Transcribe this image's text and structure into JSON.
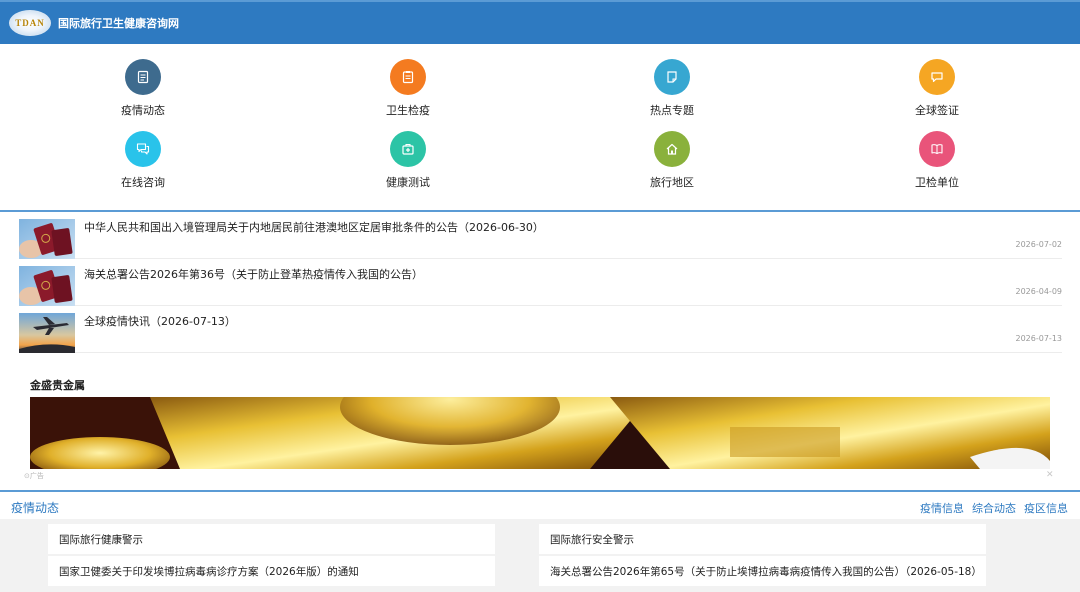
{
  "header": {
    "logo_text": "TDAN",
    "title": "国际旅行卫生健康咨询网",
    "brand_color": "#2e7ac1"
  },
  "nav": [
    {
      "label": "疫情动态",
      "icon": "document-icon",
      "color": "#3e6b8e"
    },
    {
      "label": "卫生检疫",
      "icon": "clipboard-icon",
      "color": "#f47b20"
    },
    {
      "label": "热点专题",
      "icon": "page-icon",
      "color": "#37a7d1"
    },
    {
      "label": "全球签证",
      "icon": "chat-bubble-icon",
      "color": "#f5a623"
    },
    {
      "label": "在线咨询",
      "icon": "chat-icon",
      "color": "#29c3ea"
    },
    {
      "label": "健康测试",
      "icon": "first-aid-icon",
      "color": "#2cc4a6"
    },
    {
      "label": "旅行地区",
      "icon": "home-icon",
      "color": "#8ab13c"
    },
    {
      "label": "卫检单位",
      "icon": "book-icon",
      "color": "#e9547a"
    }
  ],
  "news": [
    {
      "title": "中华人民共和国出入境管理局关于内地居民前往港澳地区定居审批条件的公告（2026-06-30）",
      "date": "2026-07-02",
      "thumb": "passport"
    },
    {
      "title": "海关总署公告2026年第36号（关于防止登革热疫情传入我国的公告）",
      "date": "2026-04-09",
      "thumb": "passport"
    },
    {
      "title": "全球疫情快讯（2026-07-13）",
      "date": "2026-07-13",
      "thumb": "airplane"
    }
  ],
  "ad": {
    "title": "金盛贵金属",
    "mark": "⊙广告",
    "close": "✕"
  },
  "section": {
    "title": "疫情动态",
    "tabs": [
      "疫情信息",
      "综合动态",
      "疫区信息"
    ]
  },
  "panels": {
    "left": [
      "国际旅行健康警示",
      "国家卫健委关于印发埃博拉病毒病诊疗方案（2026年版）的通知"
    ],
    "right": [
      "国际旅行安全警示",
      "海关总署公告2026年第65号（关于防止埃博拉病毒病疫情传入我国的公告）（2026-05-18）"
    ]
  }
}
